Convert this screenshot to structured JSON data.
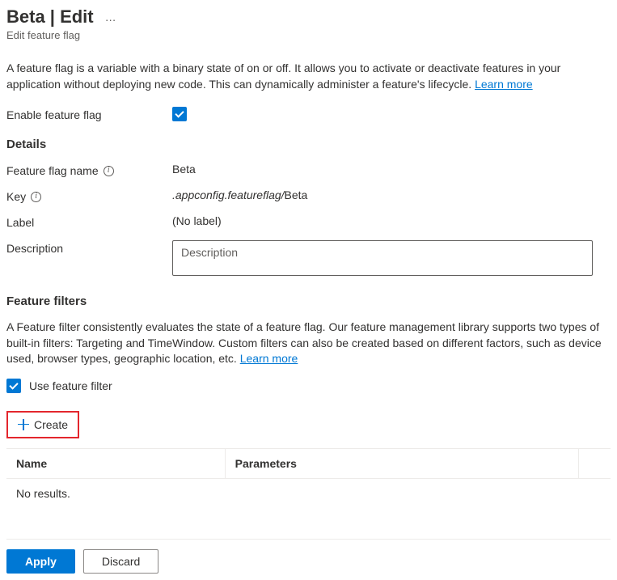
{
  "header": {
    "title": "Beta | Edit",
    "subtitle": "Edit feature flag",
    "more_label": "…"
  },
  "intro": {
    "text": "A feature flag is a variable with a binary state of on or off. It allows you to activate or deactivate features in your application without deploying new code. This can dynamically administer a feature's lifecycle. ",
    "learn_more": "Learn more"
  },
  "enable": {
    "label": "Enable feature flag",
    "checked": true
  },
  "details": {
    "heading": "Details",
    "name_label": "Feature flag name",
    "name_value": "Beta",
    "key_label": "Key",
    "key_prefix": ".appconfig.featureflag/",
    "key_value": "Beta",
    "label_label": "Label",
    "label_value": "(No label)",
    "desc_label": "Description",
    "desc_placeholder": "Description",
    "desc_value": ""
  },
  "filters": {
    "heading": "Feature filters",
    "text": "A Feature filter consistently evaluates the state of a feature flag. Our feature management library supports two types of built-in filters: Targeting and TimeWindow. Custom filters can also be created based on different factors, such as device used, browser types, geographic location, etc. ",
    "learn_more": "Learn more",
    "use_label": "Use feature filter",
    "use_checked": true,
    "create_label": "Create",
    "cols": {
      "name": "Name",
      "params": "Parameters"
    },
    "empty": "No results."
  },
  "footer": {
    "apply": "Apply",
    "discard": "Discard"
  }
}
